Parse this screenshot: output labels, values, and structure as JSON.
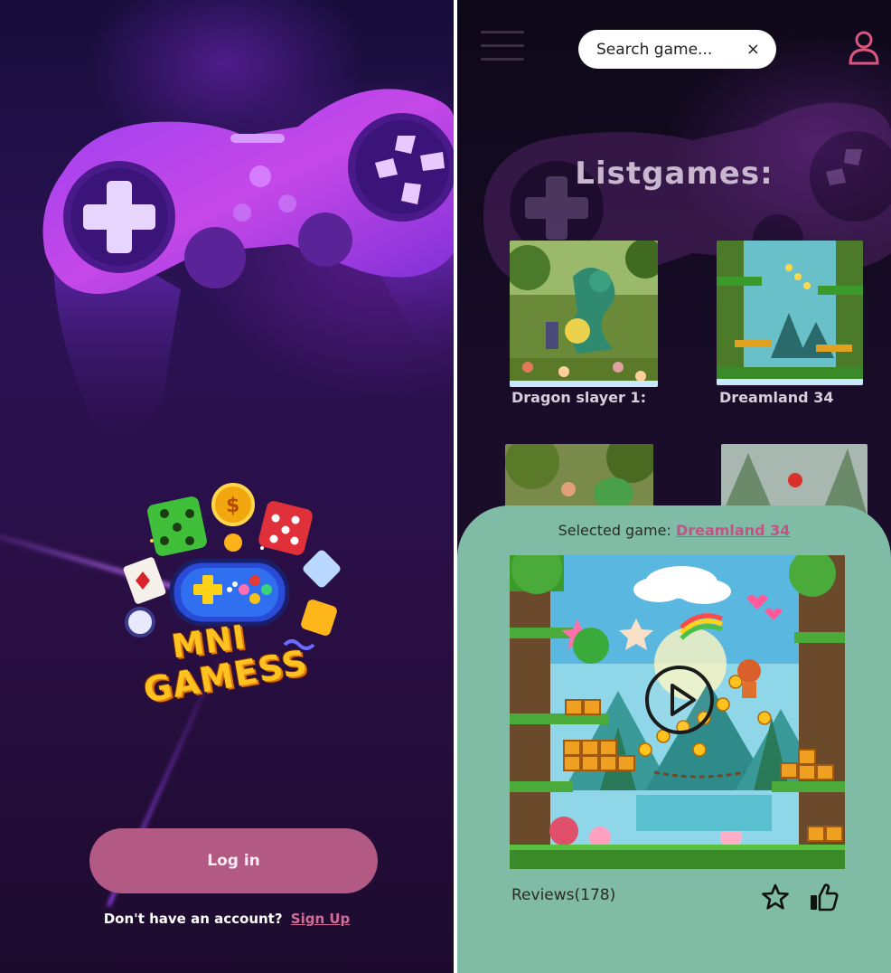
{
  "login_screen": {
    "brand": {
      "line1": "MNI",
      "line2": "GAMESS"
    },
    "login_button_label": "Log in",
    "signup_prompt": "Don't have an account?",
    "signup_link": "Sign Up",
    "colors": {
      "button": "#b35a84",
      "link": "#d36d97"
    }
  },
  "list_screen": {
    "search": {
      "value": "",
      "placeholder": "Search game...",
      "clear_icon": "×"
    },
    "title": "Listgames:",
    "games": [
      {
        "title": "Dragon slayer 1:"
      },
      {
        "title": "Dreamland 34"
      },
      {
        "title": ""
      },
      {
        "title": ""
      }
    ],
    "sheet": {
      "selected_prefix": "Selected game:",
      "selected_name": "Dreamland 34",
      "reviews_label": "Reviews(178)",
      "background_color": "#80bba6"
    },
    "icons": [
      "menu-icon",
      "close-icon",
      "profile-icon",
      "play-icon",
      "star-icon",
      "thumbs-up-icon"
    ]
  }
}
